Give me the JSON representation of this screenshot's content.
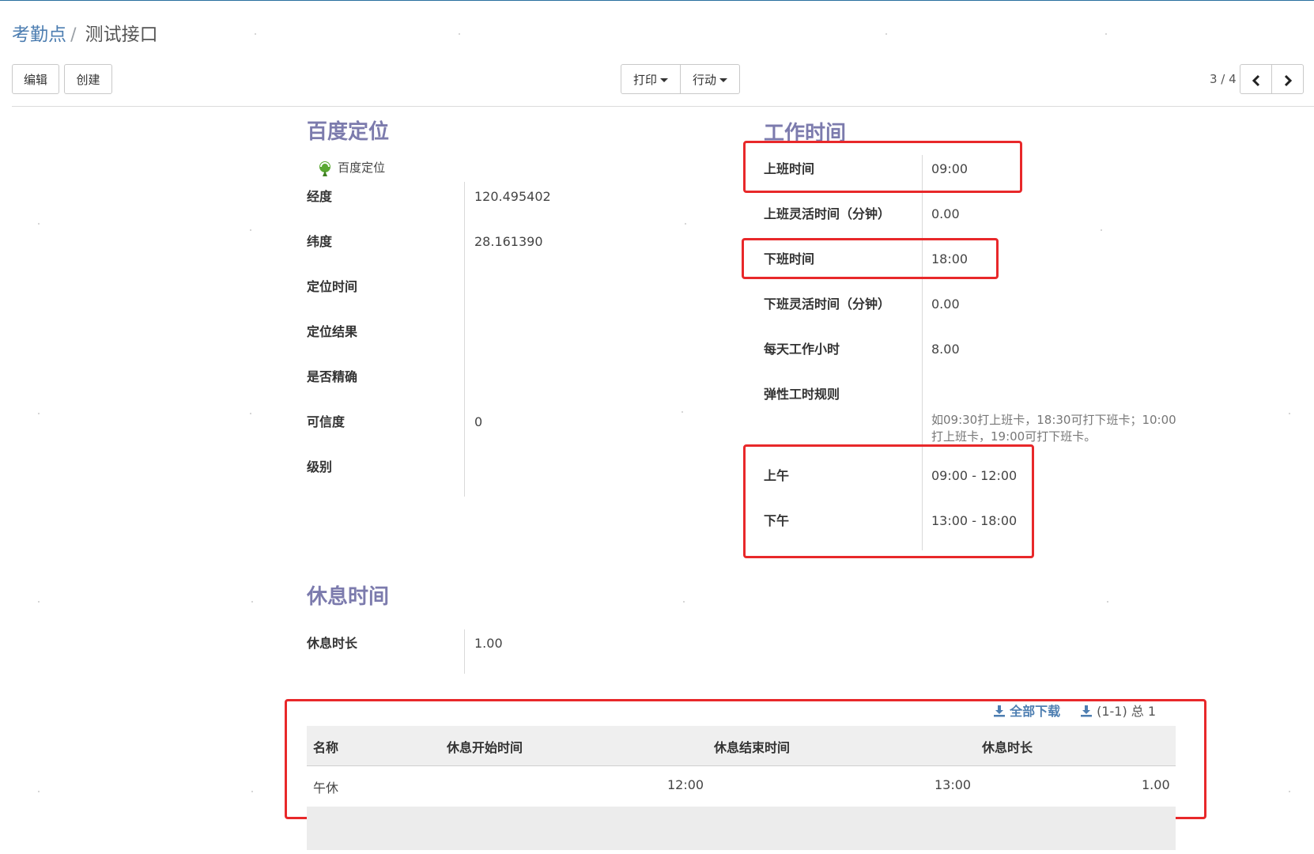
{
  "breadcrumb": {
    "parent": "考勤点",
    "separator": "/",
    "current": "测试接口"
  },
  "toolbar": {
    "edit_label": "编辑",
    "create_label": "创建",
    "print_label": "打印",
    "action_label": "行动"
  },
  "pager": {
    "text": "3 / 4"
  },
  "location": {
    "title": "百度定位",
    "map_link": "百度定位",
    "fields": [
      {
        "label": "经度",
        "value": "120.495402"
      },
      {
        "label": "纬度",
        "value": "28.161390"
      },
      {
        "label": "定位时间",
        "value": ""
      },
      {
        "label": "定位结果",
        "value": ""
      },
      {
        "label": "是否精确",
        "value": ""
      },
      {
        "label": "可信度",
        "value": "0"
      },
      {
        "label": "级别",
        "value": ""
      }
    ]
  },
  "work_time": {
    "title": "工作时间",
    "fields": [
      {
        "label": "上班时间",
        "value": "09:00"
      },
      {
        "label": "上班灵活时间（分钟）",
        "value": "0.00"
      },
      {
        "label": "下班时间",
        "value": "18:00"
      },
      {
        "label": "下班灵活时间（分钟）",
        "value": "0.00"
      },
      {
        "label": "每天工作小时",
        "value": "8.00"
      },
      {
        "label": "弹性工时规则",
        "value": ""
      }
    ],
    "hint": "如09:30打上班卡，18:30可打下班卡；10:00打上班卡，19:00可打下班卡。",
    "am_label": "上午",
    "am_start": "09:00",
    "am_end": "12:00",
    "pm_label": "下午",
    "pm_start": "13:00",
    "pm_end": "18:00",
    "range_sep": "-"
  },
  "rest": {
    "title": "休息时间",
    "duration_label": "休息时长",
    "duration_value": "1.00",
    "download_all": "全部下载",
    "pager_text": "(1-1) 总 1",
    "columns": [
      "名称",
      "休息开始时间",
      "休息结束时间",
      "休息时长"
    ],
    "rows": [
      {
        "name": "午休",
        "start": "12:00",
        "end": "13:00",
        "duration": "1.00"
      }
    ]
  },
  "colors": {
    "accent": "#4d7eb1",
    "section_title": "#7c7bad",
    "highlight_box": "#e8282a"
  }
}
